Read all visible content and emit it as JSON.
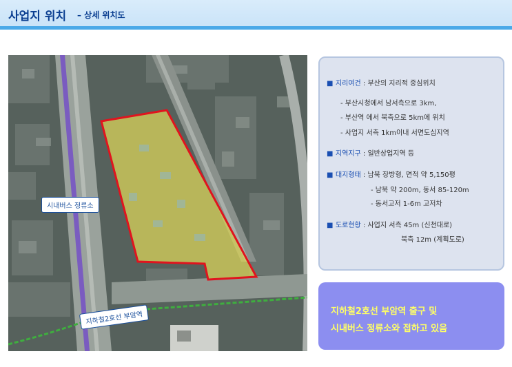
{
  "header": {
    "title": "사업지 위치",
    "subtitle": "– 상세 위치도"
  },
  "map": {
    "bus_stop_label": "시내버스 정류소",
    "subway_label": "지하철2호선 부암역",
    "site_outline_color": "#e0141e",
    "site_fill_color": "#d9d35a",
    "subway_line_color": "#3fae3f",
    "highlight_road_color": "#7a5cc0"
  },
  "info": {
    "items": [
      {
        "key": "지리여건",
        "text": " : 부산의 지리적 중심위치",
        "details": [
          "- 부산시청에서 남서측으로 3km,",
          "- 부산역 에서 북측으로 5km에 위치",
          "- 사업지 서측 1km이내 서면도심지역"
        ]
      },
      {
        "key": "지역지구",
        "text": " : 일반상업지역 등",
        "details": []
      },
      {
        "key": "대지형태",
        "text": " : 남북 장방형, 면적 약 5,150평",
        "details": [
          "- 남북 약 200m, 동서 85-120m",
          "- 동서고저 1-6m 고저차"
        ]
      },
      {
        "key": "도로현황",
        "text": " : 사업지 서측 45m (신천대로)",
        "details": [
          "북측 12m (계획도로)"
        ]
      }
    ]
  },
  "callout": {
    "line1": "지하철2호선 부암역 출구 및",
    "line2": "시내버스 정류소와 접하고 있음"
  }
}
